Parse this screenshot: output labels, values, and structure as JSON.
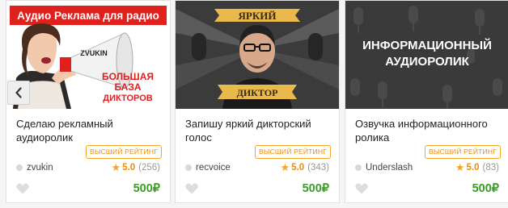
{
  "currency_symbol": "₽",
  "colors": {
    "badge": "#f08c00",
    "star": "#f5a623",
    "price": "#3a9d23"
  },
  "cards": [
    {
      "image_text": [
        "Аудио Реклама для радио",
        "ZVUKIN",
        "БОЛЬШАЯ",
        "БАЗА",
        "ДИКТОРОВ"
      ],
      "title": "Сделаю рекламный аудиоролик",
      "badge": "ВЫСШИЙ РЕЙТИНГ",
      "seller": "zvukin",
      "rating": "5.0",
      "reviews": "(256)",
      "price": "500"
    },
    {
      "image_text": [
        "ЯРКИЙ",
        "ДИКТОР"
      ],
      "title": "Запишу яркий дикторский голос",
      "badge": "ВЫСШИЙ РЕЙТИНГ",
      "seller": "recvoice",
      "rating": "5.0",
      "reviews": "(343)",
      "price": "500"
    },
    {
      "image_text": [
        "ИНФОРМАЦИОННЫЙ",
        "АУДИОРОЛИК"
      ],
      "title": "Озвучка информационного ролика",
      "badge": "ВЫСШИЙ РЕЙТИНГ",
      "seller": "Underslash",
      "rating": "5.0",
      "reviews": "(83)",
      "price": "500"
    }
  ]
}
